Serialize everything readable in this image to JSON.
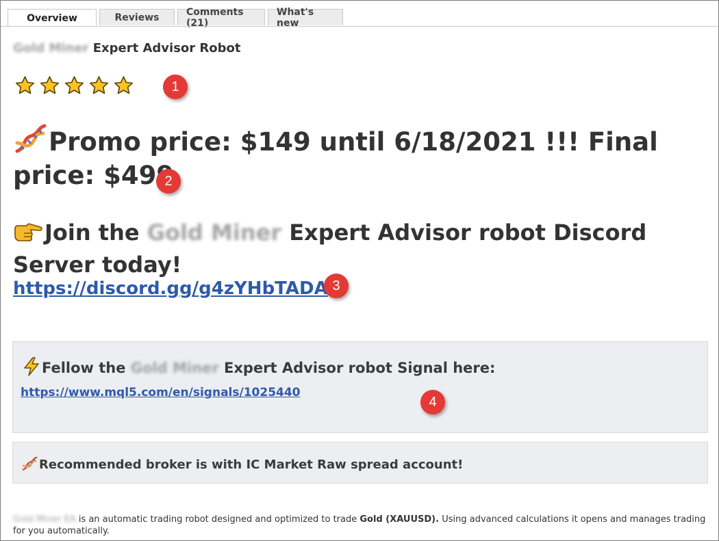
{
  "tabs": [
    {
      "label": "Overview",
      "active": true
    },
    {
      "label": "Reviews"
    },
    {
      "label": "Comments (21)"
    },
    {
      "label": "What's new"
    }
  ],
  "title": {
    "blurred": "Gold Miner",
    "text": "Expert Advisor Robot"
  },
  "rating": {
    "stars": 5,
    "max": 5
  },
  "promo": {
    "text": "Promo price: $149 until 6/18/2021  !!! Final price: $499",
    "icon": "dna-icon"
  },
  "join": {
    "prefix": "Join the",
    "blurred": "Gold Miner",
    "suffix": "Expert Advisor robot Discord Server today!",
    "icon": "pointing-hand-icon"
  },
  "discord_link": "https://discord.gg/g4zYHbTADA",
  "signal": {
    "prefix": "Fellow the",
    "blurred": "Gold Miner",
    "suffix": "Expert Advisor robot Signal here:",
    "link": "https://www.mql5.com/en/signals/1025440",
    "icon": "lightning-icon"
  },
  "broker": {
    "text": "Recommended broker is with IC Market Raw spread account!",
    "icon": "dna-icon"
  },
  "description": {
    "blurred": "Gold Miner EA",
    "text": "is an automatic trading robot designed and optimized to trade",
    "bold": "Gold (XAUUSD).",
    "rest": "Using advanced calculations it opens and manages trading for you automatically."
  },
  "annotations": [
    "1",
    "2",
    "3",
    "4"
  ],
  "colors": {
    "link": "#2f5aa8",
    "badge": "#e53935",
    "box_bg": "#eceef1",
    "star": "#f7c325"
  }
}
